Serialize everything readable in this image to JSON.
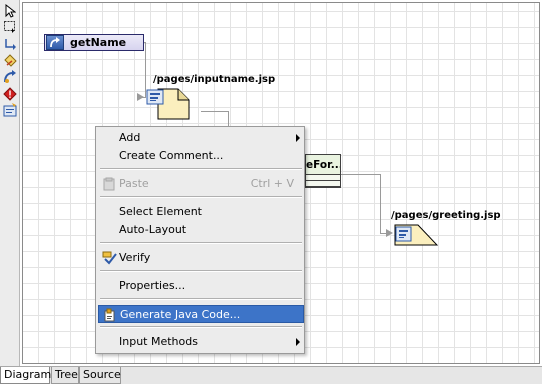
{
  "palette": {
    "tools": [
      "select-arrow-icon",
      "marquee-select-icon",
      "connection-icon",
      "page-icon",
      "action-icon",
      "exception-icon",
      "form-bean-icon"
    ]
  },
  "diagram": {
    "action_label": "getName",
    "page1_label": "/pages/inputname.jsp",
    "form_label": "eFor...",
    "page2_label": "/pages/greeting.jsp"
  },
  "context_menu": {
    "items": [
      {
        "label": "Add",
        "submenu": true
      },
      {
        "label": "Create Comment..."
      },
      {
        "label": "Paste",
        "shortcut": "Ctrl + V",
        "disabled": true
      },
      {
        "label": "Select Element"
      },
      {
        "label": "Auto-Layout"
      },
      {
        "label": "Verify"
      },
      {
        "label": "Properties..."
      },
      {
        "label": "Generate Java Code...",
        "selected": true
      },
      {
        "label": "Input Methods",
        "submenu": true
      }
    ]
  },
  "tabs": [
    {
      "label": "Diagram",
      "active": true
    },
    {
      "label": "Tree"
    },
    {
      "label": "Source"
    }
  ],
  "colors": {
    "menu_highlight": "#3d74c8",
    "action_node_fill": "#d7d4ef",
    "page_note_fill": "#fbefbe"
  }
}
